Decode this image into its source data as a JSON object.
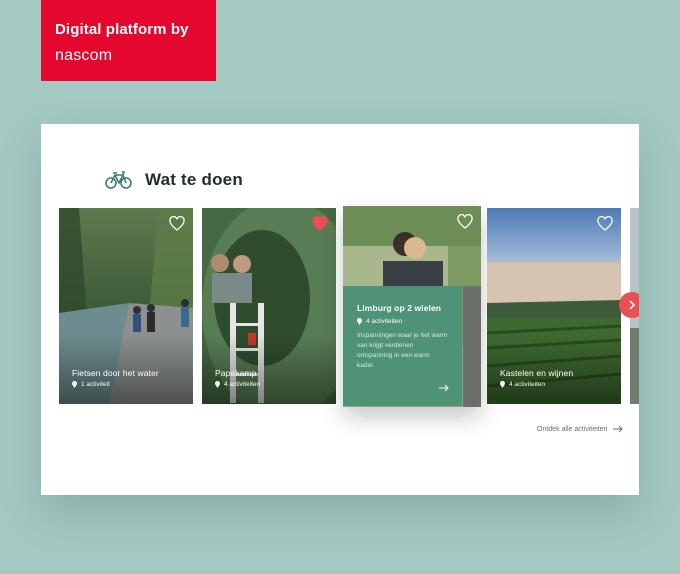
{
  "branding": {
    "line1": "Digital platform by",
    "line2": "nascom"
  },
  "section": {
    "title": "Wat te doen",
    "icon": "bicycle-icon"
  },
  "tiles": [
    {
      "title": "Fietsen door het water",
      "count": "1 activiteit",
      "favorite": false
    },
    {
      "title": "Papakamp",
      "count": "4 activiteiten",
      "favorite": true
    },
    {
      "title": "Limburg op 2 wielen",
      "count": "4 activiteiten",
      "favorite": false,
      "description": "Inspanningen waar je het warm van krijgt verdienen ontspanning in een warm kader."
    },
    {
      "title": "Kastelen en wijnen",
      "count": "4 activiteiten",
      "favorite": false
    }
  ],
  "discover_link": "Ontdek alle activiteiten",
  "colors": {
    "brand_red": "#e4082f",
    "feature_green": "#4e9277",
    "favorite_red": "#e94f55",
    "background": "#a4c9c3"
  }
}
